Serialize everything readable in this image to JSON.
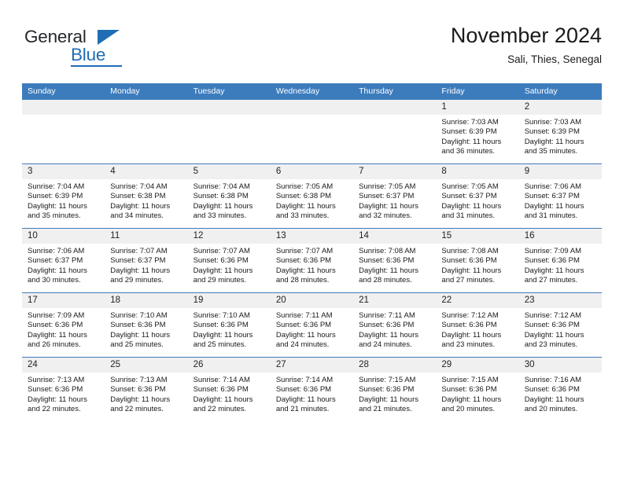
{
  "logo": {
    "name_part1": "General",
    "name_part2": "Blue",
    "triangle_icon": "blue-triangle-icon",
    "brand_color": "#1f6db4"
  },
  "header": {
    "title": "November 2024",
    "subtitle": "Sali, Thies, Senegal"
  },
  "colors": {
    "header_blue": "#3c7cbd",
    "date_band_gray": "#f0f0f0",
    "text": "#1a1a1a"
  },
  "calendar": {
    "weekday_headers": [
      "Sunday",
      "Monday",
      "Tuesday",
      "Wednesday",
      "Thursday",
      "Friday",
      "Saturday"
    ],
    "weeks": [
      [
        {
          "day": "",
          "empty": true
        },
        {
          "day": "",
          "empty": true
        },
        {
          "day": "",
          "empty": true
        },
        {
          "day": "",
          "empty": true
        },
        {
          "day": "",
          "empty": true
        },
        {
          "day": "1",
          "sunrise": "Sunrise: 7:03 AM",
          "sunset": "Sunset: 6:39 PM",
          "daylight": "Daylight: 11 hours and 36 minutes."
        },
        {
          "day": "2",
          "sunrise": "Sunrise: 7:03 AM",
          "sunset": "Sunset: 6:39 PM",
          "daylight": "Daylight: 11 hours and 35 minutes."
        }
      ],
      [
        {
          "day": "3",
          "sunrise": "Sunrise: 7:04 AM",
          "sunset": "Sunset: 6:39 PM",
          "daylight": "Daylight: 11 hours and 35 minutes."
        },
        {
          "day": "4",
          "sunrise": "Sunrise: 7:04 AM",
          "sunset": "Sunset: 6:38 PM",
          "daylight": "Daylight: 11 hours and 34 minutes."
        },
        {
          "day": "5",
          "sunrise": "Sunrise: 7:04 AM",
          "sunset": "Sunset: 6:38 PM",
          "daylight": "Daylight: 11 hours and 33 minutes."
        },
        {
          "day": "6",
          "sunrise": "Sunrise: 7:05 AM",
          "sunset": "Sunset: 6:38 PM",
          "daylight": "Daylight: 11 hours and 33 minutes."
        },
        {
          "day": "7",
          "sunrise": "Sunrise: 7:05 AM",
          "sunset": "Sunset: 6:37 PM",
          "daylight": "Daylight: 11 hours and 32 minutes."
        },
        {
          "day": "8",
          "sunrise": "Sunrise: 7:05 AM",
          "sunset": "Sunset: 6:37 PM",
          "daylight": "Daylight: 11 hours and 31 minutes."
        },
        {
          "day": "9",
          "sunrise": "Sunrise: 7:06 AM",
          "sunset": "Sunset: 6:37 PM",
          "daylight": "Daylight: 11 hours and 31 minutes."
        }
      ],
      [
        {
          "day": "10",
          "sunrise": "Sunrise: 7:06 AM",
          "sunset": "Sunset: 6:37 PM",
          "daylight": "Daylight: 11 hours and 30 minutes."
        },
        {
          "day": "11",
          "sunrise": "Sunrise: 7:07 AM",
          "sunset": "Sunset: 6:37 PM",
          "daylight": "Daylight: 11 hours and 29 minutes."
        },
        {
          "day": "12",
          "sunrise": "Sunrise: 7:07 AM",
          "sunset": "Sunset: 6:36 PM",
          "daylight": "Daylight: 11 hours and 29 minutes."
        },
        {
          "day": "13",
          "sunrise": "Sunrise: 7:07 AM",
          "sunset": "Sunset: 6:36 PM",
          "daylight": "Daylight: 11 hours and 28 minutes."
        },
        {
          "day": "14",
          "sunrise": "Sunrise: 7:08 AM",
          "sunset": "Sunset: 6:36 PM",
          "daylight": "Daylight: 11 hours and 28 minutes."
        },
        {
          "day": "15",
          "sunrise": "Sunrise: 7:08 AM",
          "sunset": "Sunset: 6:36 PM",
          "daylight": "Daylight: 11 hours and 27 minutes."
        },
        {
          "day": "16",
          "sunrise": "Sunrise: 7:09 AM",
          "sunset": "Sunset: 6:36 PM",
          "daylight": "Daylight: 11 hours and 27 minutes."
        }
      ],
      [
        {
          "day": "17",
          "sunrise": "Sunrise: 7:09 AM",
          "sunset": "Sunset: 6:36 PM",
          "daylight": "Daylight: 11 hours and 26 minutes."
        },
        {
          "day": "18",
          "sunrise": "Sunrise: 7:10 AM",
          "sunset": "Sunset: 6:36 PM",
          "daylight": "Daylight: 11 hours and 25 minutes."
        },
        {
          "day": "19",
          "sunrise": "Sunrise: 7:10 AM",
          "sunset": "Sunset: 6:36 PM",
          "daylight": "Daylight: 11 hours and 25 minutes."
        },
        {
          "day": "20",
          "sunrise": "Sunrise: 7:11 AM",
          "sunset": "Sunset: 6:36 PM",
          "daylight": "Daylight: 11 hours and 24 minutes."
        },
        {
          "day": "21",
          "sunrise": "Sunrise: 7:11 AM",
          "sunset": "Sunset: 6:36 PM",
          "daylight": "Daylight: 11 hours and 24 minutes."
        },
        {
          "day": "22",
          "sunrise": "Sunrise: 7:12 AM",
          "sunset": "Sunset: 6:36 PM",
          "daylight": "Daylight: 11 hours and 23 minutes."
        },
        {
          "day": "23",
          "sunrise": "Sunrise: 7:12 AM",
          "sunset": "Sunset: 6:36 PM",
          "daylight": "Daylight: 11 hours and 23 minutes."
        }
      ],
      [
        {
          "day": "24",
          "sunrise": "Sunrise: 7:13 AM",
          "sunset": "Sunset: 6:36 PM",
          "daylight": "Daylight: 11 hours and 22 minutes."
        },
        {
          "day": "25",
          "sunrise": "Sunrise: 7:13 AM",
          "sunset": "Sunset: 6:36 PM",
          "daylight": "Daylight: 11 hours and 22 minutes."
        },
        {
          "day": "26",
          "sunrise": "Sunrise: 7:14 AM",
          "sunset": "Sunset: 6:36 PM",
          "daylight": "Daylight: 11 hours and 22 minutes."
        },
        {
          "day": "27",
          "sunrise": "Sunrise: 7:14 AM",
          "sunset": "Sunset: 6:36 PM",
          "daylight": "Daylight: 11 hours and 21 minutes."
        },
        {
          "day": "28",
          "sunrise": "Sunrise: 7:15 AM",
          "sunset": "Sunset: 6:36 PM",
          "daylight": "Daylight: 11 hours and 21 minutes."
        },
        {
          "day": "29",
          "sunrise": "Sunrise: 7:15 AM",
          "sunset": "Sunset: 6:36 PM",
          "daylight": "Daylight: 11 hours and 20 minutes."
        },
        {
          "day": "30",
          "sunrise": "Sunrise: 7:16 AM",
          "sunset": "Sunset: 6:36 PM",
          "daylight": "Daylight: 11 hours and 20 minutes."
        }
      ]
    ]
  }
}
